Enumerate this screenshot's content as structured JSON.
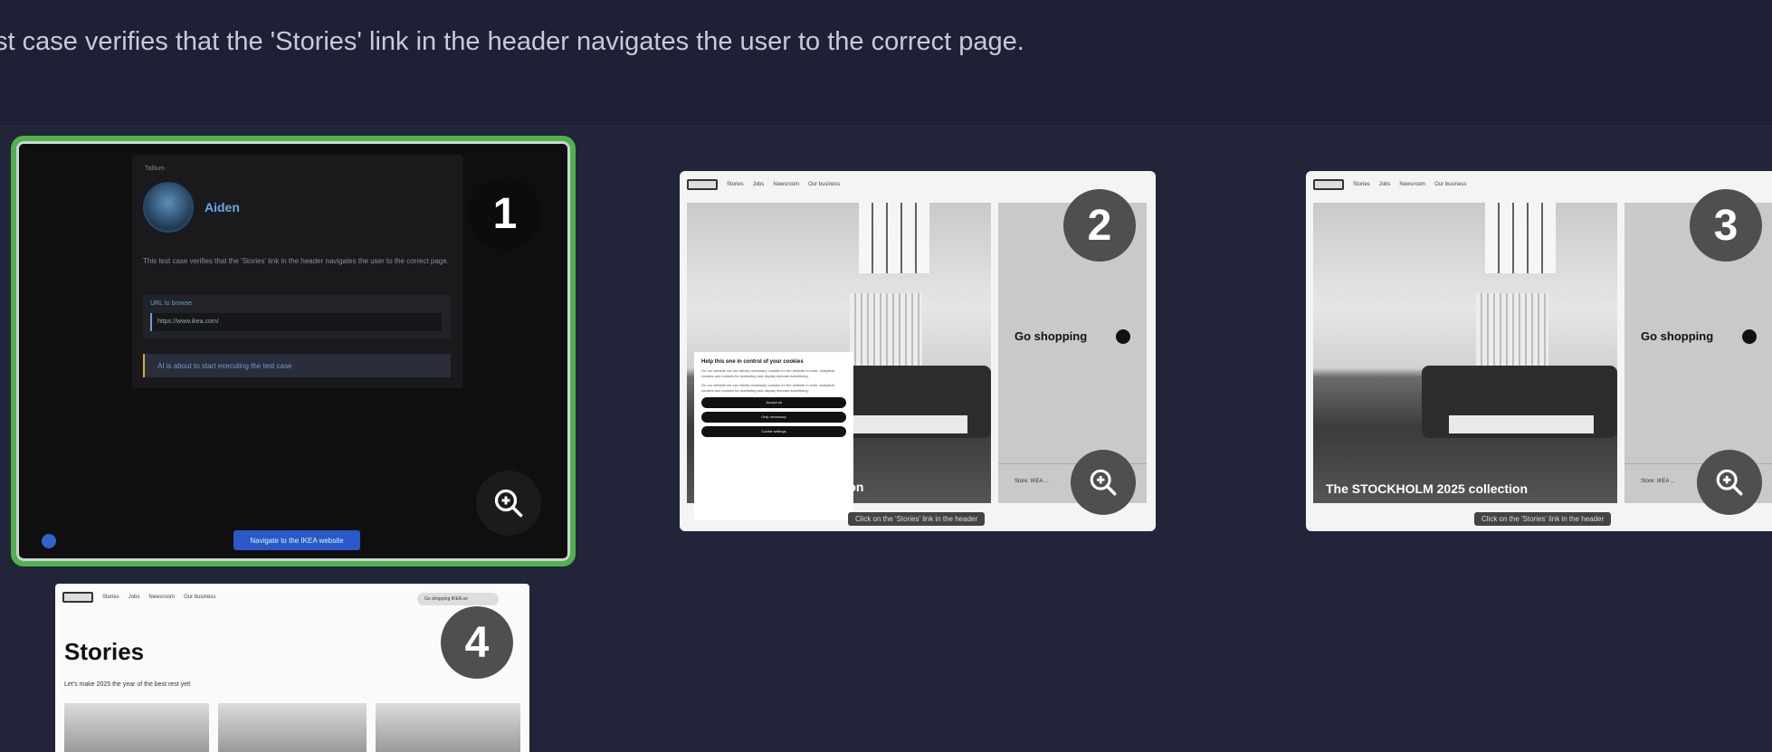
{
  "description": "st case verifies that the 'Stories' link in the header navigates the user to the correct page.",
  "steps": [
    {
      "number": "1",
      "chat": {
        "label": "Tallium",
        "user_name": "Aiden",
        "text": "This test case verifies that the 'Stories' link in the header navigates the user to the correct page.",
        "url_label": "URL to browse",
        "url_value": "https://www.ikea.com/",
        "status": "AI is about to start executing the test case",
        "button": "Navigate to the IKEA website"
      }
    },
    {
      "number": "2",
      "page": {
        "nav": [
          "Stories",
          "Jobs",
          "Newsroom",
          "Our business"
        ],
        "go_shopping": "Go shopping",
        "side_footer": "Store: IKEA ...",
        "caption": "ction",
        "tooltip": "Click on the 'Stories' link in the header",
        "cookie_title": "Help this one in control of your cookies",
        "cookie_text": "On our website we use strictly necessary cookies for the website to work, analytical cookies and cookies for marketing and display relevant advertising.",
        "cookie_buttons": [
          "Accept all",
          "Only necessary",
          "Cookie settings"
        ]
      }
    },
    {
      "number": "3",
      "page": {
        "nav": [
          "Stories",
          "Jobs",
          "Newsroom",
          "Our business"
        ],
        "go_shopping": "Go shopping",
        "side_footer": "Store: IKEA ...",
        "caption": "The STOCKHOLM 2025 collection",
        "tooltip": "Click on the 'Stories' link in the header"
      }
    },
    {
      "number": "4",
      "page": {
        "nav": [
          "Stories",
          "Jobs",
          "Newsroom",
          "Our business"
        ],
        "search": "Go shopping IKEA.se",
        "title": "Stories",
        "subtitle": "Let's make 2025 the year of the best rest yet!"
      }
    }
  ],
  "colors": {
    "selected_border": "#4fb34b",
    "badge_bg": "#555555"
  },
  "icons": {
    "zoom": "zoom-in-icon"
  }
}
